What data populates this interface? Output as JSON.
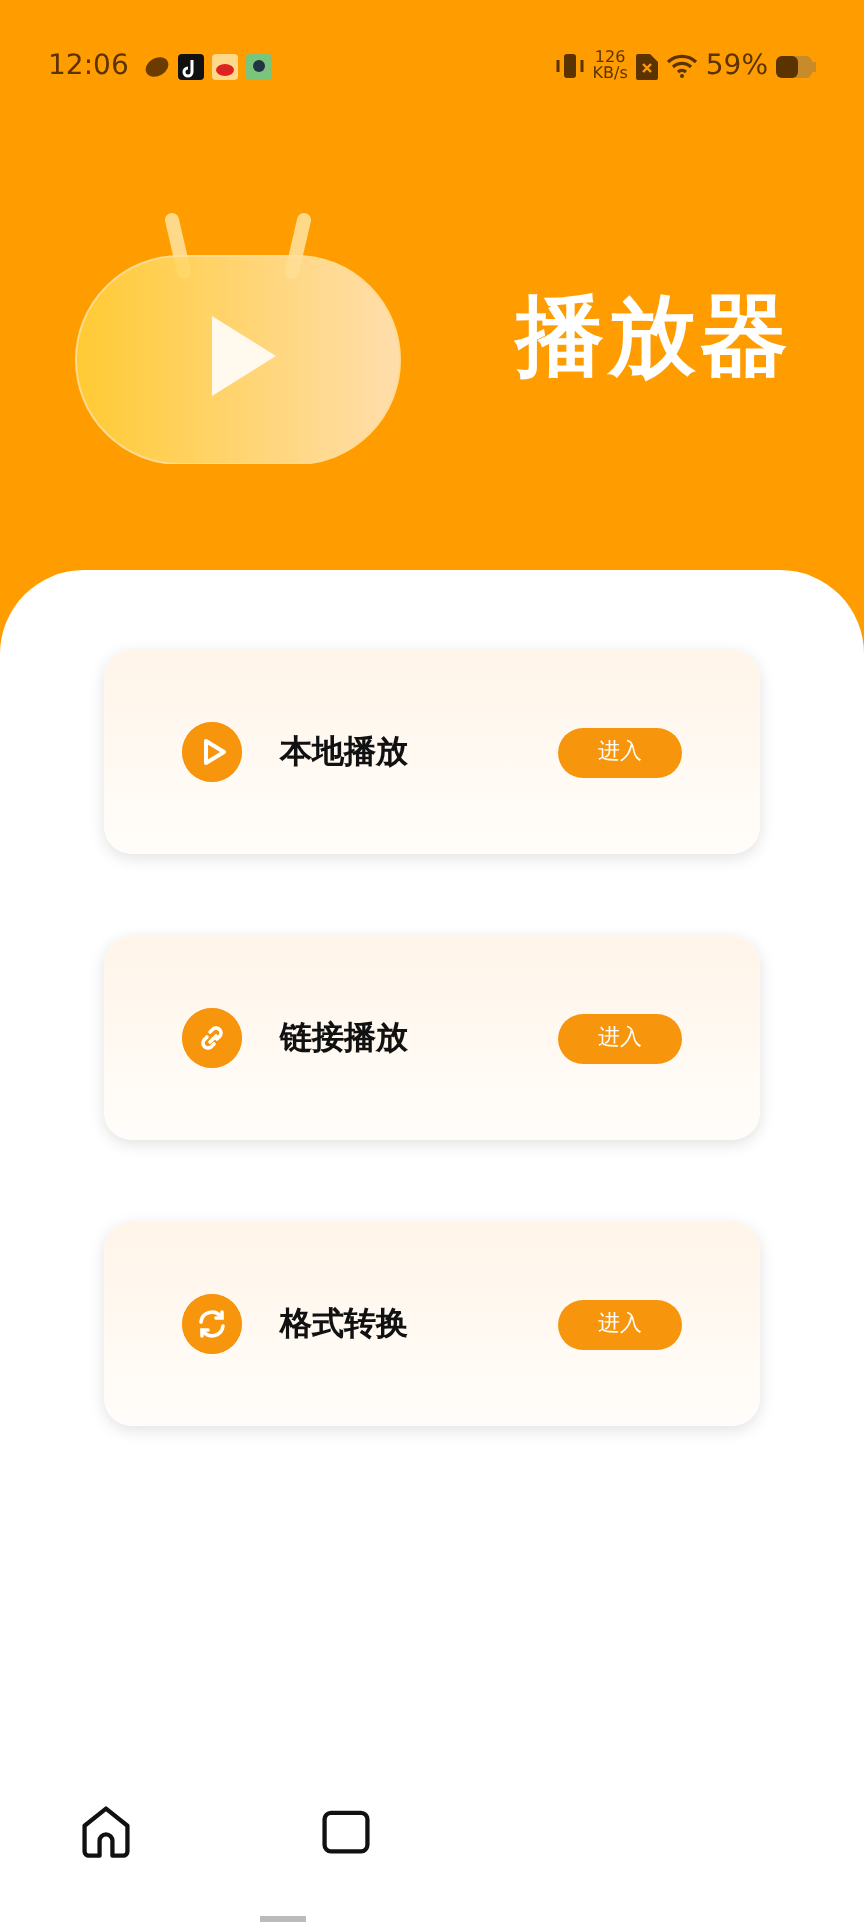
{
  "status_bar": {
    "time": "12:06",
    "speed_value": "126",
    "speed_unit": "KB/s",
    "battery": "59%"
  },
  "header": {
    "title": "播放器"
  },
  "entries": [
    {
      "kind": "play",
      "label": "本地播放",
      "button": "进入"
    },
    {
      "kind": "link",
      "label": "链接播放",
      "button": "进入"
    },
    {
      "kind": "convert",
      "label": "格式转换",
      "button": "进入"
    }
  ],
  "bottom_nav": [
    {
      "kind": "home"
    },
    {
      "kind": "box"
    }
  ]
}
